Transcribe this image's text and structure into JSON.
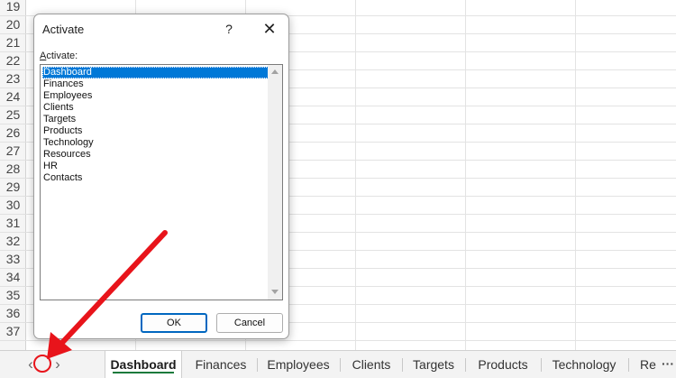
{
  "grid": {
    "row_numbers": [
      "19",
      "20",
      "21",
      "22",
      "23",
      "24",
      "25",
      "26",
      "27",
      "28",
      "29",
      "30",
      "31",
      "32",
      "33",
      "34",
      "35",
      "36",
      "37"
    ]
  },
  "dialog": {
    "title": "Activate",
    "help_label": "?",
    "close_label": "✕",
    "list_label_mnemonic": "A",
    "list_label_rest": "ctivate:",
    "items": [
      "Dashboard",
      "Finances",
      "Employees",
      "Clients",
      "Targets",
      "Products",
      "Technology",
      "Resources",
      "HR",
      "Contacts"
    ],
    "selected_item": "Dashboard",
    "ok_label": "OK",
    "cancel_label": "Cancel"
  },
  "tabbar": {
    "prev_arrow": "‹",
    "next_arrow": "›",
    "active_tab": "Dashboard",
    "tabs": [
      "Dashboard",
      "Finances",
      "Employees",
      "Clients",
      "Targets",
      "Products",
      "Technology",
      "Re"
    ],
    "more_label": "···"
  },
  "annotation": {
    "color": "#e8141b",
    "shape": "arrow-with-circle"
  },
  "colors": {
    "selection": "#0078d7",
    "active_tab_underline": "#1a7a3c",
    "ok_border": "#0067c0"
  }
}
